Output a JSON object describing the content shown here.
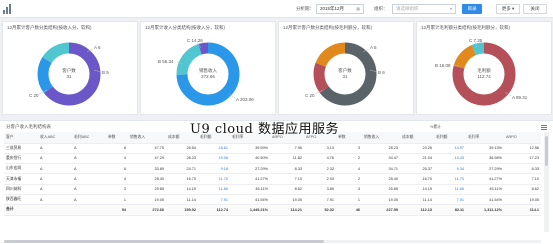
{
  "filter": {
    "period_label": "分析期：",
    "period_value": "2015年12月",
    "org_label": "组织：",
    "org_placeholder": "请选择组织",
    "query_btn": "目录",
    "more_btn": "更多",
    "close_btn": "关闭"
  },
  "panels": [
    {
      "title": "12月累计客户数分类结构(按收入分，软和)",
      "center_top": "客户数",
      "center_val": "31",
      "labels": [
        "A 6",
        "B 5",
        "C 20"
      ]
    },
    {
      "title": "12月累计收入分类结构(按收入分，软和)",
      "center_top": "销售收入",
      "center_val": "272.66",
      "labels": [
        "C 14.26",
        "B 55.34",
        "A 203.06"
      ]
    },
    {
      "title": "12月累计客户数分类结构(按毛利额分，软和)",
      "center_top": "客户数",
      "center_val": "31",
      "labels": [
        "A 5",
        "B 6",
        "C 20"
      ]
    },
    {
      "title": "12月累计毛利额分类结构(按毛利额分，软和)",
      "center_top": "毛利额",
      "center_val": "112.74",
      "labels": [
        "C 7.35",
        "B 16.08",
        "A 89.31"
      ]
    }
  ],
  "colors": {
    "blue": "#2a97e8",
    "teal": "#4fc6d0",
    "purple": "#6b57c8",
    "gray": "#5a6468",
    "orange": "#e08a1e",
    "red": "#b5505a"
  },
  "table": {
    "title": "分客户收入毛利结构表",
    "group_header": "%累计",
    "headers": [
      "客户",
      "收入ABC",
      "毛利ABC",
      "单数",
      "销售收入",
      "成本额",
      "毛利额",
      "毛利率",
      "ARPO",
      "AFPO",
      "单数",
      "销售收入",
      "成本额",
      "毛利额",
      "毛利率",
      "ARPO"
    ],
    "rows": [
      [
        "三成贸易",
        "A",
        "A",
        "6",
        "47.75",
        "28.54",
        "18.61",
        "39.59%",
        "7.96",
        "3.13",
        "3",
        "28.23",
        "23.26",
        "14.97",
        "39.13%",
        "12.56"
      ],
      [
        "重庆恒行",
        "A",
        "A",
        "4",
        "47.29",
        "28.23",
        "19.06",
        "40.50%",
        "11.82",
        "4.76",
        "2",
        "34.47",
        "21.04",
        "13.43",
        "38.98%",
        "17.23"
      ],
      [
        "山东宏润",
        "A",
        "A",
        "6",
        "33.89",
        "24.71",
        "9.18",
        "27.29%",
        "8.33",
        "2.32",
        "4",
        "34.71",
        "25.37",
        "9.34",
        "27.29%",
        "8.33"
      ],
      [
        "天津永福",
        "A",
        "A",
        "4",
        "28.40",
        "16.70",
        "11.70",
        "41.27%",
        "7.10",
        "2.93",
        "2",
        "28.40",
        "16.70",
        "11.70",
        "41.27%",
        "7.10"
      ],
      [
        "四川纳科",
        "A",
        "A",
        "3",
        "25.85",
        "14.19",
        "11.66",
        "45.11%",
        "8.62",
        "3.89",
        "3",
        "25.85",
        "14.19",
        "11.66",
        "45.11%",
        "8.62"
      ],
      [
        "陕西鑫旺",
        "A",
        "A",
        "1",
        "19.05",
        "11.14",
        "7.91",
        "41.54%",
        "19.05",
        "7.91",
        "1",
        "19.05",
        "11.14",
        "7.91",
        "41.54%",
        "19.05"
      ]
    ],
    "total": [
      "合计",
      "",
      "",
      "54",
      "272.66",
      "159.92",
      "112.74",
      "1,449.21%",
      "114.21",
      "52.32",
      "46",
      "227.59",
      "112.13",
      "82.11",
      "1,311.12%",
      "114.1"
    ]
  },
  "overlay_text": "U9 cloud    数据应用服务"
}
